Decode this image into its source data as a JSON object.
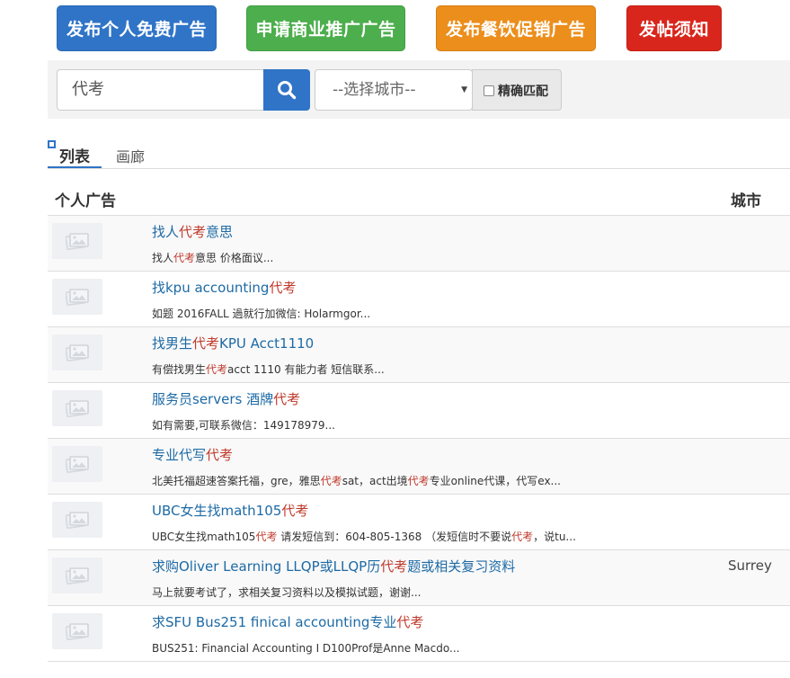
{
  "top_buttons": [
    {
      "label": "发布个人免费广告"
    },
    {
      "label": "申请商业推广广告"
    },
    {
      "label": "发布餐饮促销广告"
    },
    {
      "label": "发帖须知"
    }
  ],
  "search": {
    "query": "代考",
    "city_placeholder": "--选择城市--",
    "exact_match_label": "精确匹配"
  },
  "tabs": {
    "list": "列表",
    "gallery": "画廊"
  },
  "table": {
    "col_ads": "个人广告",
    "col_city": "城市"
  },
  "highlight_term": "代考",
  "listings": [
    {
      "title": "找人代考意思",
      "desc": "找人代考意思 价格面议...",
      "city": ""
    },
    {
      "title": "找kpu accounting代考",
      "desc": "如题 2016FALL 過就行加微信: Holarmgor...",
      "city": ""
    },
    {
      "title": "找男生代考KPU Acct1110",
      "desc": "有偿找男生代考acct 1110 有能力者 短信联系...",
      "city": ""
    },
    {
      "title": "服务员servers 酒牌代考",
      "desc": "如有需要,可联系微信：149178979...",
      "city": ""
    },
    {
      "title": "专业代写代考",
      "desc": " 北美托福超速答案托福，gre，雅思代考sat，act出境代考专业online代课，代写ex...",
      "city": ""
    },
    {
      "title": "UBC女生找math105代考",
      "desc": "UBC女生找math105代考 请发短信到：604-805-1368 （发短信时不要说代考，说tu...",
      "city": ""
    },
    {
      "title": "求购Oliver Learning LLQP或LLQP历代考题或相关复习资料",
      "desc": "马上就要考试了，求相关复习资料以及模拟试题，谢谢...",
      "city": "Surrey"
    },
    {
      "title": "求SFU Bus251 finical accounting专业代考",
      "desc": "BUS251: Financial Accounting I D100Prof是Anne Macdo...",
      "city": ""
    }
  ],
  "colors": {
    "primary": "#2f74c7",
    "green": "#4cae4c",
    "orange": "#ec8e1b",
    "red": "#d9261c",
    "link": "#1d6aa5",
    "highlight": "#c0392b"
  }
}
